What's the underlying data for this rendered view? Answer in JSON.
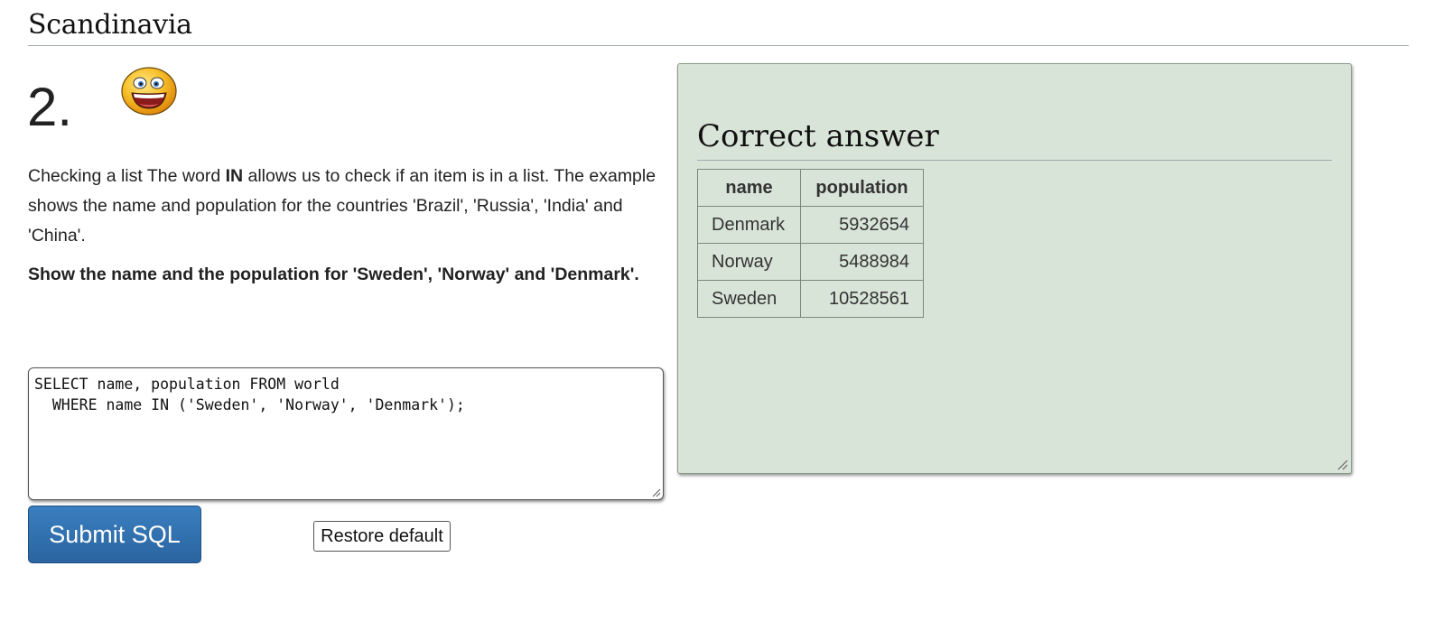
{
  "section": {
    "title": "Scandinavia"
  },
  "question": {
    "number": "2.",
    "intro_before": "Checking a list The word ",
    "intro_bold": "IN",
    "intro_after": " allows us to check if an item is in a list. The example shows the name and population for the countries 'Brazil', 'Russia', 'India' and 'China'.",
    "task": "Show the name and the population for 'Sweden', 'Norway' and 'Denmark'.",
    "smiley_icon": "laughing-smiley-icon"
  },
  "editor": {
    "sql": "SELECT name, population FROM world\n  WHERE name IN ('Sweden', 'Norway', 'Denmark');"
  },
  "buttons": {
    "submit_label": "Submit SQL",
    "restore_label": "Restore default",
    "submit_color": "#2f6eab"
  },
  "answer": {
    "title": "Correct answer",
    "panel_color": "#d9e4d9",
    "columns": [
      "name",
      "population"
    ],
    "rows": [
      {
        "name": "Denmark",
        "population": "5932654"
      },
      {
        "name": "Norway",
        "population": "5488984"
      },
      {
        "name": "Sweden",
        "population": "10528561"
      }
    ]
  }
}
